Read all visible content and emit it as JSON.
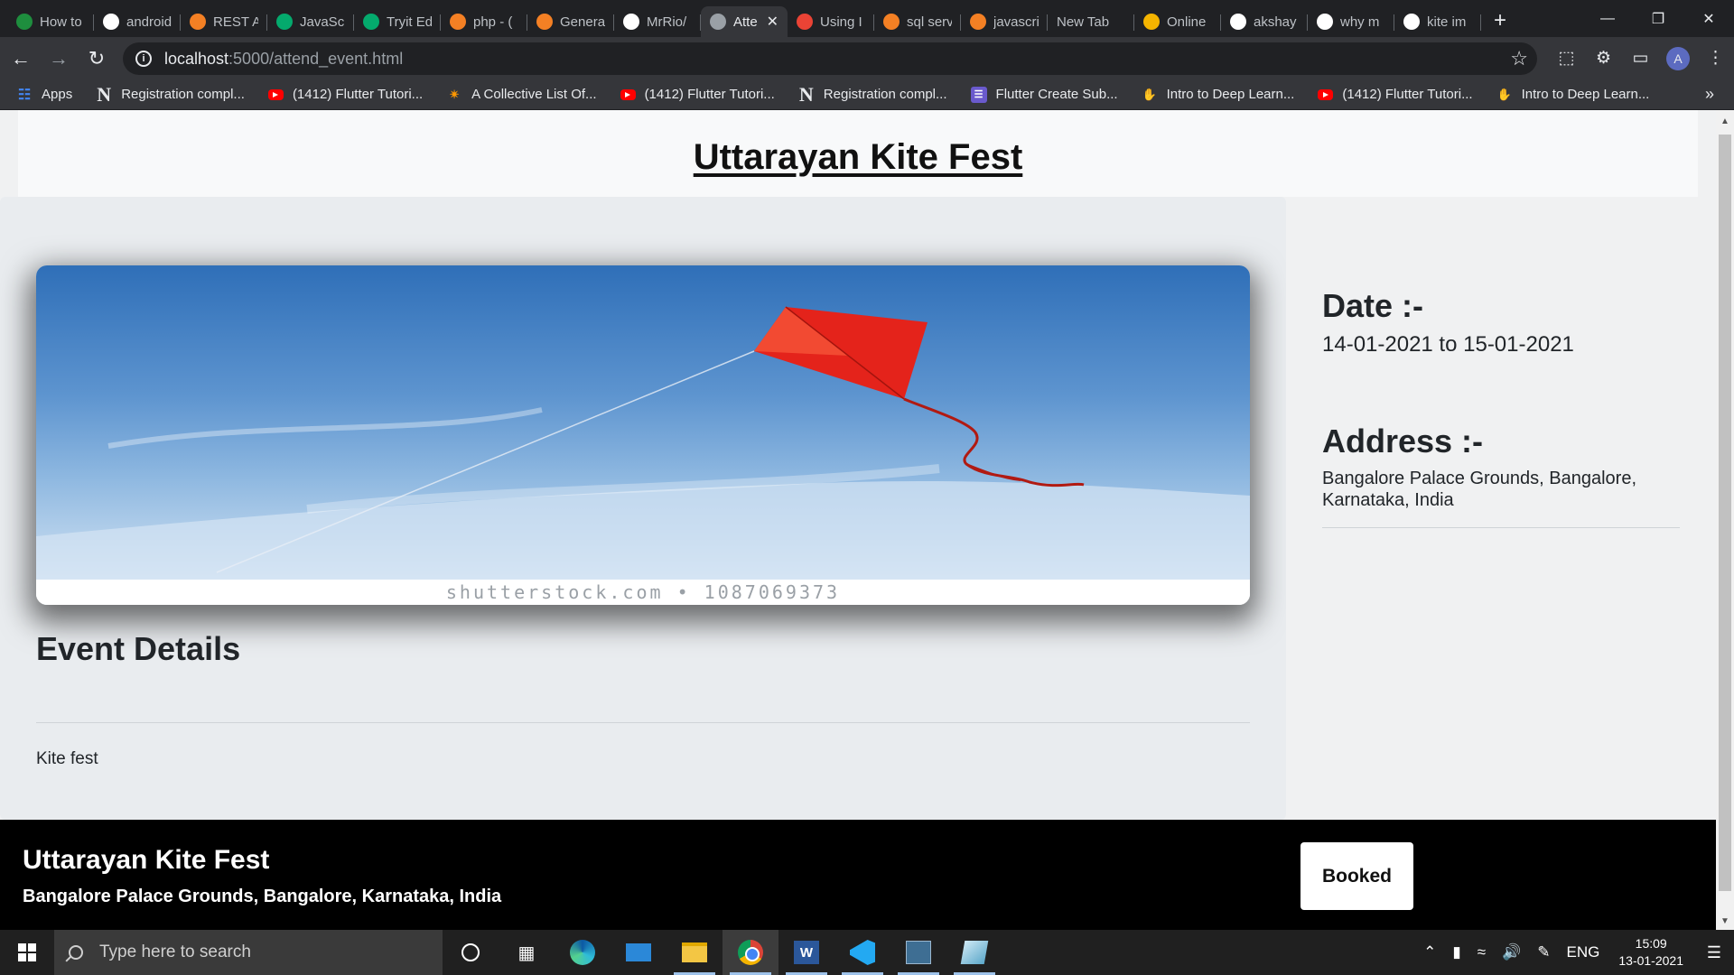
{
  "browser": {
    "tabs": [
      {
        "title": "How to",
        "favicon": "infinity-icon",
        "color": "#1e8e3e"
      },
      {
        "title": "android",
        "favicon": "google-icon",
        "color": "#ffffff"
      },
      {
        "title": "REST A",
        "favicon": "stackoverflow-icon",
        "color": "#f48024"
      },
      {
        "title": "JavaScr",
        "favicon": "w3schools-icon",
        "color": "#04aa6d"
      },
      {
        "title": "Tryit Ed",
        "favicon": "w3schools-icon",
        "color": "#04aa6d"
      },
      {
        "title": "php - (",
        "favicon": "stackoverflow-icon",
        "color": "#f48024"
      },
      {
        "title": "Genera",
        "favicon": "stackoverflow-icon",
        "color": "#f48024"
      },
      {
        "title": "MrRio/",
        "favicon": "github-icon",
        "color": "#ffffff"
      },
      {
        "title": "Atte",
        "favicon": "globe-icon",
        "color": "#9aa0a6",
        "active": true
      },
      {
        "title": "Using I",
        "favicon": "gmail-icon",
        "color": "#ea4335"
      },
      {
        "title": "sql serv",
        "favicon": "stackoverflow-icon",
        "color": "#f48024"
      },
      {
        "title": "javascri",
        "favicon": "stackoverflow-icon",
        "color": "#f48024"
      },
      {
        "title": "New Tab",
        "favicon": "",
        "color": ""
      },
      {
        "title": "Online",
        "favicon": "slides-icon",
        "color": "#f4b400"
      },
      {
        "title": "akshay",
        "favicon": "github-icon",
        "color": "#ffffff"
      },
      {
        "title": "why m",
        "favicon": "google-icon",
        "color": "#ffffff"
      },
      {
        "title": "kite im",
        "favicon": "google-icon",
        "color": "#ffffff"
      }
    ],
    "url_host": "localhost",
    "url_path": ":5000/attend_event.html",
    "profile_initial": "A",
    "bookmarks": [
      {
        "label": "Apps",
        "icon": "apps-grid-icon"
      },
      {
        "label": "Registration compl...",
        "icon": "notion-icon"
      },
      {
        "label": "(1412) Flutter Tutori...",
        "icon": "youtube-icon"
      },
      {
        "label": "A Collective List Of...",
        "icon": "flutter-icon"
      },
      {
        "label": "(1412) Flutter Tutori...",
        "icon": "youtube-icon"
      },
      {
        "label": "Registration compl...",
        "icon": "notion-icon"
      },
      {
        "label": "Flutter Create Sub...",
        "icon": "form-icon"
      },
      {
        "label": "Intro to Deep Learn...",
        "icon": "deeplearning-icon"
      },
      {
        "label": "(1412) Flutter Tutori...",
        "icon": "youtube-icon"
      },
      {
        "label": "Intro to Deep Learn...",
        "icon": "deeplearning-icon"
      }
    ]
  },
  "page": {
    "title": "Uttarayan Kite Fest",
    "hero_watermark": "shutterstock.com • 1087069373",
    "details_heading": "Event Details",
    "details_text": "Kite fest",
    "date_label": "Date :-",
    "date_value": "14-01-2021 to 15-01-2021",
    "address_label": "Address :-",
    "address_value": "Bangalore Palace Grounds, Bangalore, Karnataka, India"
  },
  "footer": {
    "title": "Uttarayan Kite Fest",
    "address": "Bangalore Palace Grounds, Bangalore, Karnataka, India",
    "button_label": "Booked"
  },
  "taskbar": {
    "search_placeholder": "Type here to search",
    "language": "ENG",
    "time": "15:09",
    "date": "13-01-2021"
  }
}
